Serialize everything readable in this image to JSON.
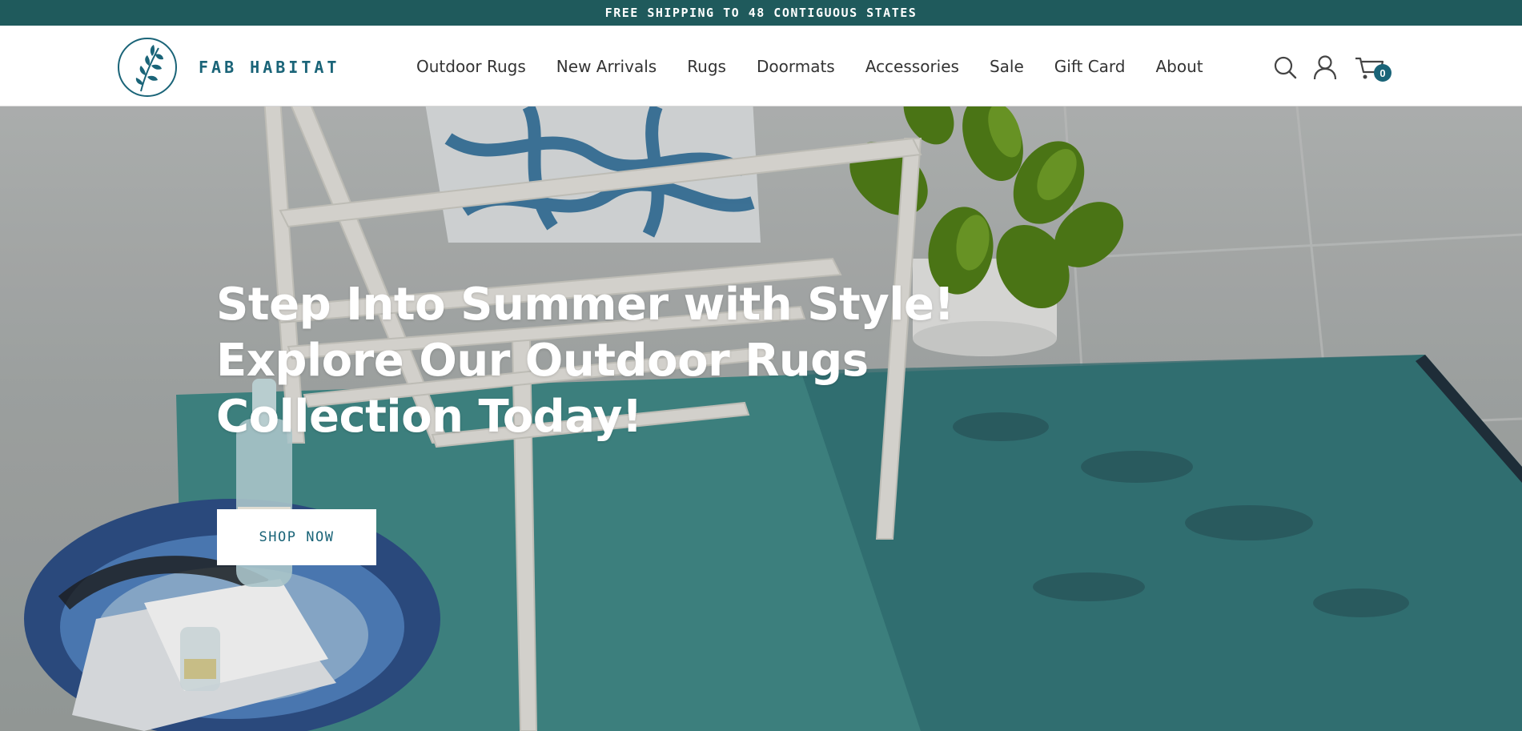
{
  "announcement": {
    "text": "FREE SHIPPING TO 48 CONTIGUOUS STATES"
  },
  "brand": {
    "name": "FAB HABITAT",
    "logo_icon": "leaf-circle-icon",
    "color": "#1a6478"
  },
  "nav": {
    "items": [
      {
        "label": "Outdoor Rugs"
      },
      {
        "label": "New Arrivals"
      },
      {
        "label": "Rugs"
      },
      {
        "label": "Doormats"
      },
      {
        "label": "Accessories"
      },
      {
        "label": "Sale"
      },
      {
        "label": "Gift Card"
      },
      {
        "label": "About"
      }
    ]
  },
  "header_icons": {
    "search": "search-icon",
    "account": "account-icon",
    "cart": "cart-icon",
    "cart_count": "0"
  },
  "hero": {
    "heading_lines": [
      "Step Into Summer with Style!",
      "Explore Our Outdoor Rugs",
      "Collection Today!"
    ],
    "cta_label": "SHOP NOW"
  },
  "colors": {
    "announcement_bg": "#1f5a5c",
    "accent": "#1a6478",
    "rug": "#3f8a87"
  }
}
